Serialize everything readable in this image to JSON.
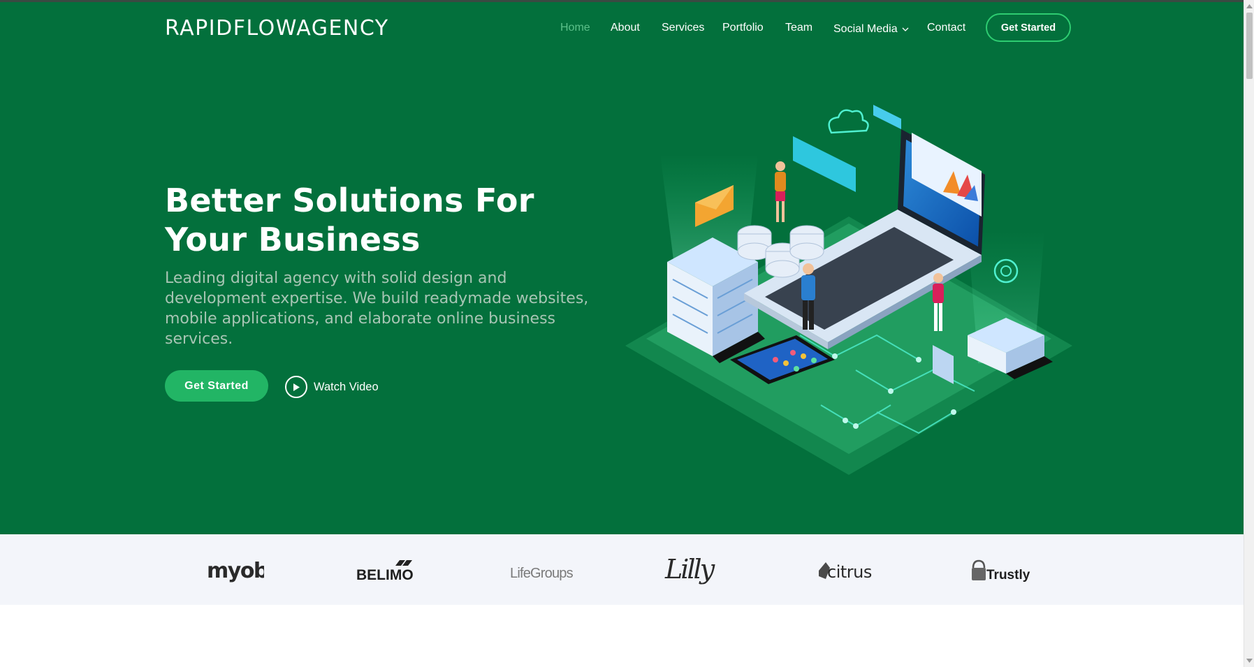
{
  "brand": {
    "logo": "RAPIDFLOWAGENCY"
  },
  "nav": {
    "items": [
      {
        "label": "Home",
        "active": true
      },
      {
        "label": "About"
      },
      {
        "label": "Services"
      },
      {
        "label": "Portfolio"
      },
      {
        "label": "Team"
      },
      {
        "label": "Social Media",
        "dropdown": true
      },
      {
        "label": "Contact"
      }
    ],
    "cta": "Get Started"
  },
  "hero": {
    "title": "Better Solutions For Your Business",
    "subtitle": "Leading digital agency with solid design and development expertise. We build readymade websites, mobile applications, and elaborate online business services.",
    "primary_button": "Get Started",
    "video_link": "Watch Video"
  },
  "clients": [
    {
      "name": "myob"
    },
    {
      "name": "BELIMO"
    },
    {
      "name": "LifeGroups"
    },
    {
      "name": "Lilly"
    },
    {
      "name": "citrus"
    },
    {
      "name": "Trustly"
    }
  ],
  "colors": {
    "hero_bg": "#03703c",
    "accent": "#22b565",
    "active_nav": "#5cc08a",
    "clients_bg": "#f3f5fa"
  }
}
